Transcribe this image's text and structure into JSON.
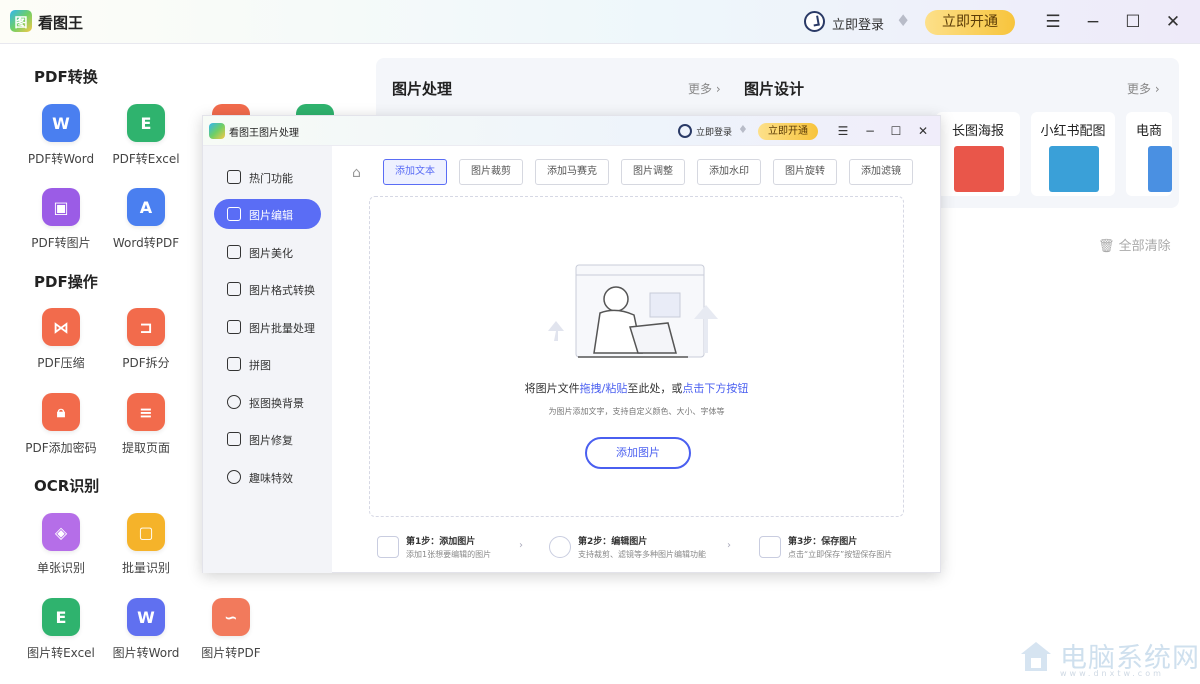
{
  "app": {
    "title": "看图王",
    "logo_char": "图"
  },
  "header": {
    "login_label": "立即登录",
    "vip_label": "立即开通"
  },
  "window_controls": {
    "menu": "☰",
    "minimize": "−",
    "maximize": "☐",
    "close": "✕"
  },
  "sections": {
    "pdf_convert": {
      "title": "PDF转换",
      "items": [
        {
          "label": "PDF转Word",
          "color": "#4a7ff0",
          "glyph": "W"
        },
        {
          "label": "PDF转Excel",
          "color": "#2fb36e",
          "glyph": "E"
        },
        {
          "label": "PDF转图片",
          "color": "#9b5ce6",
          "glyph": "▣"
        },
        {
          "label": "Word转PDF",
          "color": "#4a7ff0",
          "glyph": "A"
        }
      ]
    },
    "pdf_ops": {
      "title": "PDF操作",
      "items": [
        {
          "label": "PDF压缩",
          "color": "#f26b4c",
          "glyph": "⋈"
        },
        {
          "label": "PDF拆分",
          "color": "#f26b4c",
          "glyph": "⊐"
        },
        {
          "label": "PDF添加密码",
          "color": "#f26b4c",
          "glyph": "🔒︎"
        },
        {
          "label": "提取页面",
          "color": "#f26b4c",
          "glyph": "≡"
        }
      ]
    },
    "ocr": {
      "title": "OCR识别",
      "items": [
        {
          "label": "单张识别",
          "color": "#b56ee8",
          "glyph": "◈"
        },
        {
          "label": "批量识别",
          "color": "#f5b32a",
          "glyph": "▢"
        },
        {
          "label": "图片转Excel",
          "color": "#2fb36e",
          "glyph": "E"
        },
        {
          "label": "图片转Word",
          "color": "#6070f0",
          "glyph": "W"
        },
        {
          "label": "图片转PDF",
          "color": "#f27a5c",
          "glyph": "∽"
        }
      ]
    }
  },
  "right_panel": {
    "image_processing_title": "图片处理",
    "image_processing_more": "更多 ›",
    "image_design_title": "图片设计",
    "image_design_more": "更多 ›",
    "design_cards": [
      {
        "label": "长图海报",
        "color": "#e9564a"
      },
      {
        "label": "小红书配图",
        "color": "#3aa0d8"
      },
      {
        "label": "电商",
        "color": "#4a90e2"
      }
    ],
    "clear_all": "全部清除"
  },
  "modal": {
    "title": "看图王图片处理",
    "login_label": "立即登录",
    "vip_label": "立即开通",
    "nav": [
      "热门功能",
      "图片编辑",
      "图片美化",
      "图片格式转换",
      "图片批量处理",
      "拼图",
      "抠图换背景",
      "图片修复",
      "趣味特效"
    ],
    "tabs": [
      "添加文本",
      "图片裁剪",
      "添加马赛克",
      "图片调整",
      "添加水印",
      "图片旋转",
      "添加滤镜"
    ],
    "drop_main_prefix": "将图片文件",
    "drop_main_hl1": "拖拽/粘贴",
    "drop_main_mid": "至此处，或",
    "drop_main_hl2": "点击下方按钮",
    "drop_sub": "为图片添加文字，支持自定义颜色、大小、字体等",
    "add_button": "添加图片",
    "steps": [
      {
        "title": "第1步：添加图片",
        "desc": "添加1张想要编辑的图片"
      },
      {
        "title": "第2步：编辑图片",
        "desc": "支持裁剪、滤镜等多种图片编辑功能"
      },
      {
        "title": "第3步：保存图片",
        "desc": "点击“立即保存”按钮保存图片"
      }
    ]
  },
  "watermark": {
    "text": "电脑系统网",
    "url": "www.dnxtw.com"
  }
}
